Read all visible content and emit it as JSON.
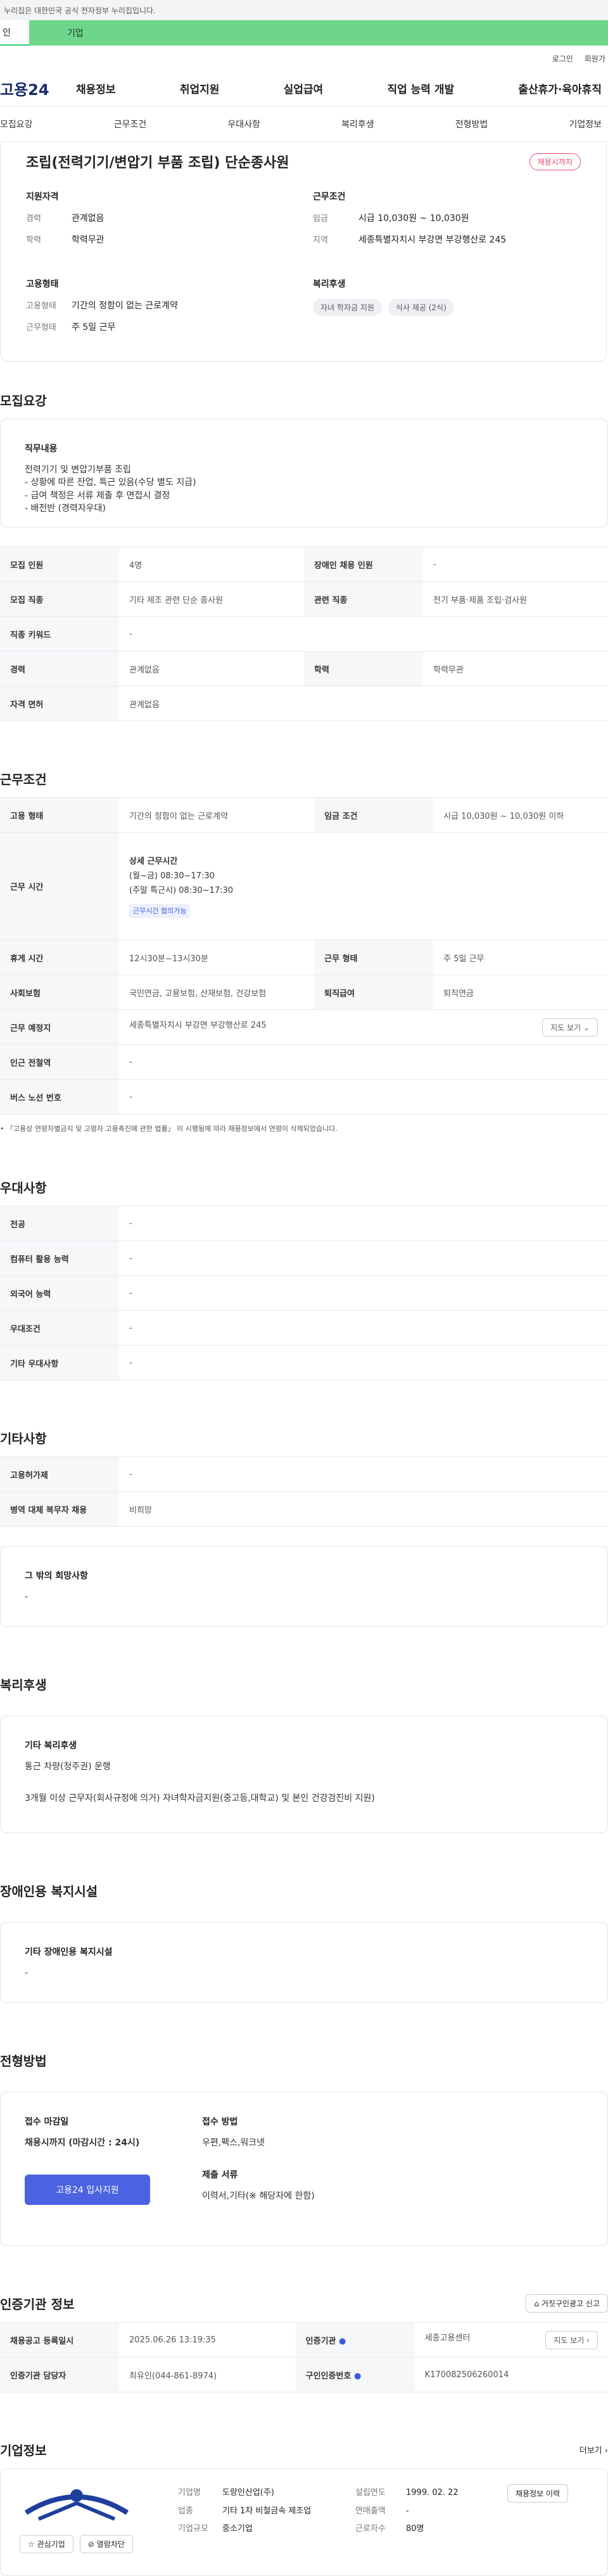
{
  "gov_notice": "누리집은 대한민국 공식 전자정부 누리집입니다.",
  "top_tabs": [
    "인",
    "기업"
  ],
  "util_links": [
    "로그인",
    "회원가"
  ],
  "logo": "고용24",
  "gnb": [
    "채용정보",
    "취업지원",
    "실업급여",
    "직업 능력 개발",
    "출산휴가·육아휴직"
  ],
  "subnav": [
    "모집요강",
    "근무조건",
    "우대사항",
    "복리후생",
    "전형방법",
    "기업정보"
  ],
  "summary": {
    "title": "조립(전력기기/변압기 부품 조립) 단순종사원",
    "badge": "채용시까지",
    "qualification": {
      "title": "지원자격",
      "rows": [
        {
          "k": "경력",
          "v": "관계없음"
        },
        {
          "k": "학력",
          "v": "학력무관"
        }
      ]
    },
    "conditions": {
      "title": "근무조건",
      "rows": [
        {
          "k": "임금",
          "v": "시급 10,030원 ~ 10,030원"
        },
        {
          "k": "지역",
          "v": "세종특별자치시 부강면 부강행산로 245"
        }
      ]
    },
    "employment": {
      "title": "고용형태",
      "rows": [
        {
          "k": "고용형태",
          "v": "기간의 정함이 없는 근로계약"
        },
        {
          "k": "근무형태",
          "v": "주 5일 근무"
        }
      ]
    },
    "welfare": {
      "title": "복리후생",
      "chips": [
        "자녀 학자금 지원",
        "식사 제공 (2식)"
      ]
    }
  },
  "recruit": {
    "title": "모집요강",
    "duty_title": "직무내용",
    "duty_lines": [
      "전력기기 및 변압기부품 조립",
      "- 상황에 따른 잔업, 특근 있음(수당 별도 지급)",
      "- 급여 책정은 서류 제출 후 면접시 결정",
      "- 배전반 (경력자우대)"
    ],
    "rows": [
      [
        {
          "h": "모집 인원",
          "v": "4명"
        },
        {
          "h": "장애인 채용 인원",
          "v": "-"
        }
      ],
      [
        {
          "h": "모집 직종",
          "v": "기타 제조 관련 단순 종사원"
        },
        {
          "h": "관련 직종",
          "v": "전기 부품·제품 조립·검사원"
        }
      ],
      [
        {
          "h": "직종 키워드",
          "v": "-"
        }
      ],
      [
        {
          "h": "경력",
          "v": "관계없음"
        },
        {
          "h": "학력",
          "v": "학력무관"
        }
      ],
      [
        {
          "h": "자격 면허",
          "v": "관계없음"
        }
      ]
    ]
  },
  "work": {
    "title": "근무조건",
    "employ_type_h": "고용 형태",
    "employ_type_v": "기간의 정함이 없는 근로계약",
    "wage_h": "임금 조건",
    "wage_v": "시급 10,030원 ~ 10,030원 이하",
    "hours_h": "근무 시간",
    "hours_lines": [
      "상세 근무시간",
      "(월~금) 08:30~17:30",
      "(주말 특근시) 08:30~17:30"
    ],
    "hours_link": "근무시간 협의가능",
    "break_h": "휴게 시간",
    "break_v": "12시30분~13시30분",
    "shift_h": "근무 형태",
    "shift_v": "주 5일 근무",
    "insurance_h": "사회보험",
    "insurance_v": "국민연금, 고용보험, 산재보험, 건강보험",
    "retire_h": "퇴직급여",
    "retire_v": "퇴직연금",
    "place_h": "근무 예정지",
    "place_v": "세종특별자치시 부강면 부강행산로 245",
    "map_btn": "지도 보기",
    "subway_h": "인근 전철역",
    "subway_v": "-",
    "bus_h": "버스 노선 번호",
    "bus_v": "-",
    "note": "「고용상 연령차별금지 및 고령자 고용촉진에 관한 법률」 이 시행됨에 따라 채용정보에서 연령이 삭제되었습니다."
  },
  "preference": {
    "title": "우대사항",
    "rows": [
      {
        "h": "전공",
        "v": "-"
      },
      {
        "h": "컴퓨터 활용 능력",
        "v": "-"
      },
      {
        "h": "외국어 능력",
        "v": "-"
      },
      {
        "h": "우대조건",
        "v": "-"
      },
      {
        "h": "기타 우대사항",
        "v": "-"
      }
    ]
  },
  "etc": {
    "title": "기타사항",
    "rows": [
      {
        "h": "고용허가제",
        "v": "-"
      },
      {
        "h": "병역 대체 복무자 채용",
        "v": "비희망"
      }
    ],
    "other_title": "그 밖의 희망사항",
    "other_v": "-"
  },
  "benefits": {
    "title": "복리후생",
    "box_title": "기타 복리후생",
    "lines": [
      "통근 차량(청주권) 운행",
      "3개월 이상 근무자(회사규정에 의거) 자녀학자금지원(중고등,대학교) 및 본인 건강검진비 지원)"
    ]
  },
  "disability": {
    "title": "장애인용 복지시설",
    "box_title": "기타 장애인용 복지시설",
    "v": "-"
  },
  "process": {
    "title": "전형방법",
    "deadline_h": "접수 마감일",
    "deadline_v": "채용시까지 (마감시간 : 24시)",
    "method_h": "접수 방법",
    "method_v": "우편,팩스,워크넷",
    "docs_h": "제출 서류",
    "docs_v": "이력서,기타(※ 해당자에 한함)",
    "apply_btn": "고용24 입사지원"
  },
  "cert": {
    "title": "인증기관 정보",
    "report_btn": "거짓구인광고 신고",
    "reg_h": "채용공고 등록일시",
    "reg_v": "2025.06.26 13:19:35",
    "org_h": "인증기관",
    "org_v": "세종고용센터",
    "map_btn": "지도 보기",
    "mgr_h": "인증기관 담당자",
    "mgr_v": "최유인(044-861-8974)",
    "id_h": "구인인증번호",
    "id_v": "K170082506260014"
  },
  "company": {
    "title": "기업정보",
    "more": "더보기",
    "name_h": "기업명",
    "name_v": "도랑인산업(주)",
    "industry_h": "업종",
    "industry_v": "기타 1차 비철금속 제조업",
    "scale_h": "기업규모",
    "scale_v": "중소기업",
    "founded_h": "설립연도",
    "founded_v": "1999. 02. 22",
    "sales_h": "연매출액",
    "sales_v": "-",
    "staff_h": "근로자수",
    "staff_v": "80명",
    "jobs_btn": "채용정보 이력",
    "fav_btn": "관심기업",
    "block_btn": "열람차단"
  },
  "colors": {
    "accent": "#4b63e0",
    "red": "#e5313e",
    "green": "#6fd58b"
  }
}
